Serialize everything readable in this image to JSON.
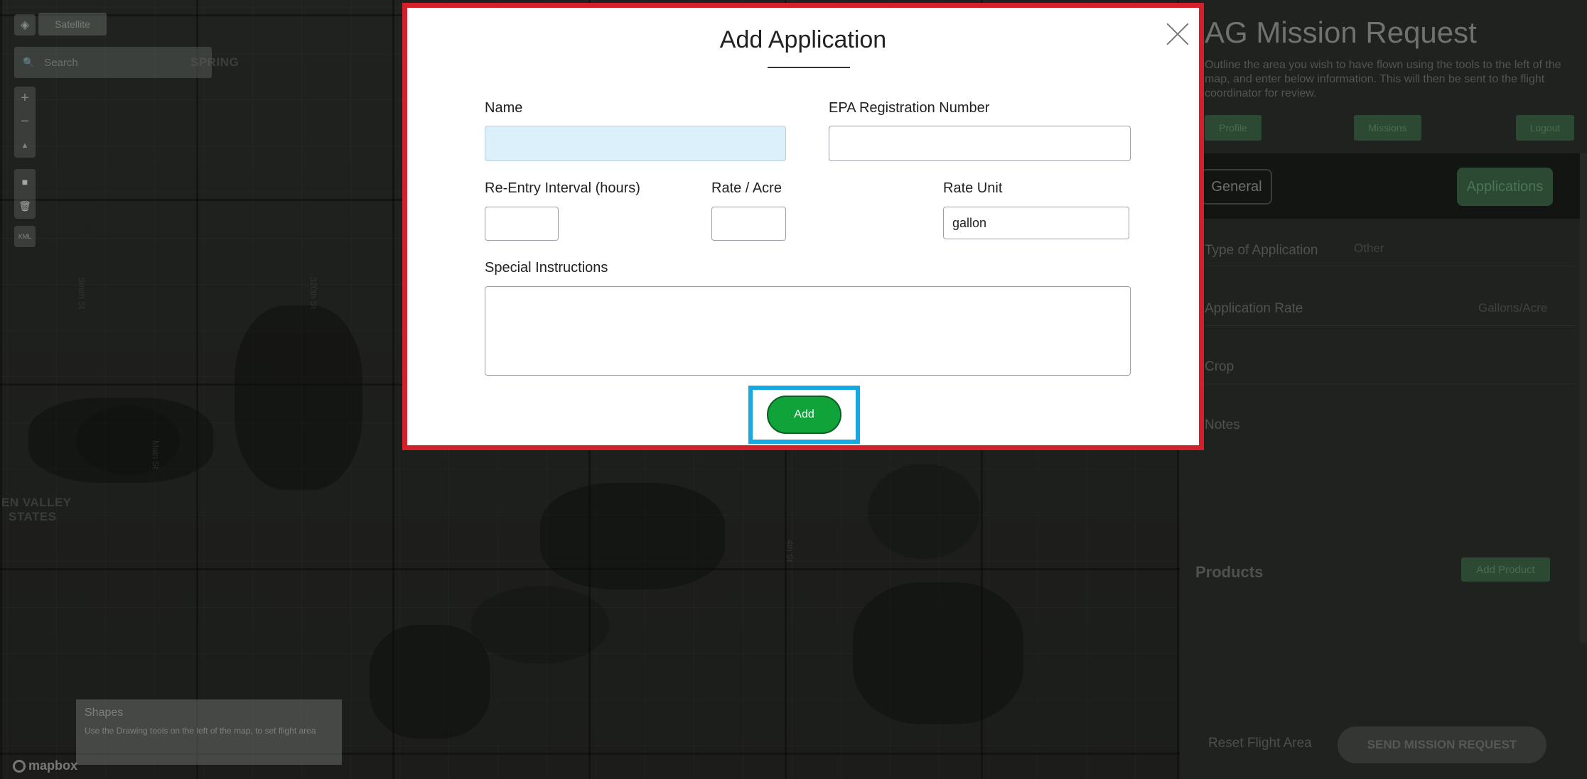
{
  "map": {
    "layers_icon": "layers-icon",
    "satellite_label": "Satellite",
    "search_placeholder": "Search",
    "zoom_in": "+",
    "zoom_out": "−",
    "compass": "▲",
    "kml_label": "KML",
    "place_labels": [
      "SPRING",
      "EN VALLEY",
      "STATES"
    ],
    "road_labels": [
      "Smith St",
      "320th St",
      "Main St",
      "4th St"
    ],
    "shapes_title": "Shapes",
    "shapes_description": "Use the Drawing tools on the left of the map, to set flight area",
    "attribution": "mapbox"
  },
  "panel": {
    "title": "AG Mission Request",
    "description": "Outline the area you wish to have flown using the tools to the left of the map, and enter below information. This will then be sent to the flight coordinator for review.",
    "buttons": {
      "profile": "Profile",
      "missions": "Missions",
      "logout": "Logout"
    },
    "tabs": {
      "general": "General",
      "applications": "Applications"
    },
    "rows": [
      {
        "label": "Type of Application",
        "value": "Other"
      },
      {
        "label": "Application Rate",
        "value": "Gallons/Acre"
      },
      {
        "label": "Crop",
        "value": ""
      },
      {
        "label": "Notes",
        "value": ""
      }
    ],
    "products_label": "Products",
    "add_product_label": "Add Product",
    "reset_label": "Reset Flight Area",
    "send_label": "SEND MISSION REQUEST"
  },
  "modal": {
    "title": "Add Application",
    "fields": {
      "name": {
        "label": "Name",
        "value": ""
      },
      "epa": {
        "label": "EPA Registration Number",
        "value": ""
      },
      "reentry": {
        "label": "Re-Entry Interval (hours)",
        "value": ""
      },
      "rate": {
        "label": "Rate / Acre",
        "value": ""
      },
      "rate_unit": {
        "label": "Rate Unit",
        "value": "gallon"
      },
      "special": {
        "label": "Special Instructions",
        "value": ""
      }
    },
    "add_label": "Add",
    "colors": {
      "highlight_border": "#d3202a",
      "target_frame": "#16a8e0",
      "add_button": "#0fa33a"
    }
  }
}
